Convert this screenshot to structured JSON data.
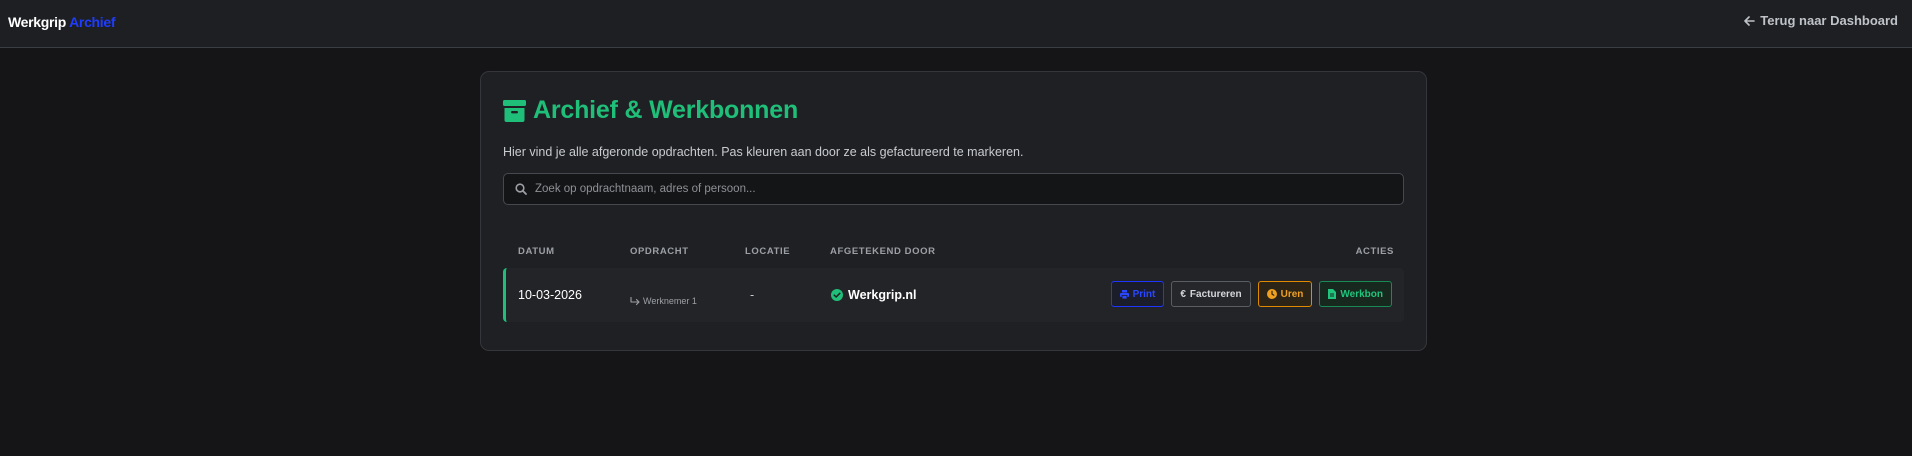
{
  "header": {
    "brand_part1": "Werkgrip",
    "brand_part2": "Archief",
    "back_label": "Terug naar Dashboard"
  },
  "page": {
    "title": "Archief & Werkbonnen",
    "subtitle": "Hier vind je alle afgeronde opdrachten. Pas kleuren aan door ze als gefactureerd te markeren.",
    "search_placeholder": "Zoek op opdrachtnaam, adres of persoon..."
  },
  "table": {
    "columns": [
      "DATUM",
      "OPDRACHT",
      "LOCATIE",
      "AFGETEKEND DOOR",
      "ACTIES"
    ],
    "rows": [
      {
        "date": "10-03-2026",
        "job_sub": "Werknemer 1",
        "location": "-",
        "signed_by": "Werkgrip.nl",
        "actions": {
          "print": "Print",
          "invoice": "Factureren",
          "hours": "Uren",
          "workorder": "Werkbon"
        }
      }
    ]
  },
  "colors": {
    "accent_green": "#1fbf7a",
    "brand_blue": "#1f3cff",
    "hours_orange": "#f0a020"
  },
  "icons": [
    "arrow-left-icon",
    "archive-box-icon",
    "search-icon",
    "return-arrow-icon",
    "check-circle-icon",
    "printer-icon",
    "euro-icon",
    "clock-icon",
    "document-icon"
  ]
}
